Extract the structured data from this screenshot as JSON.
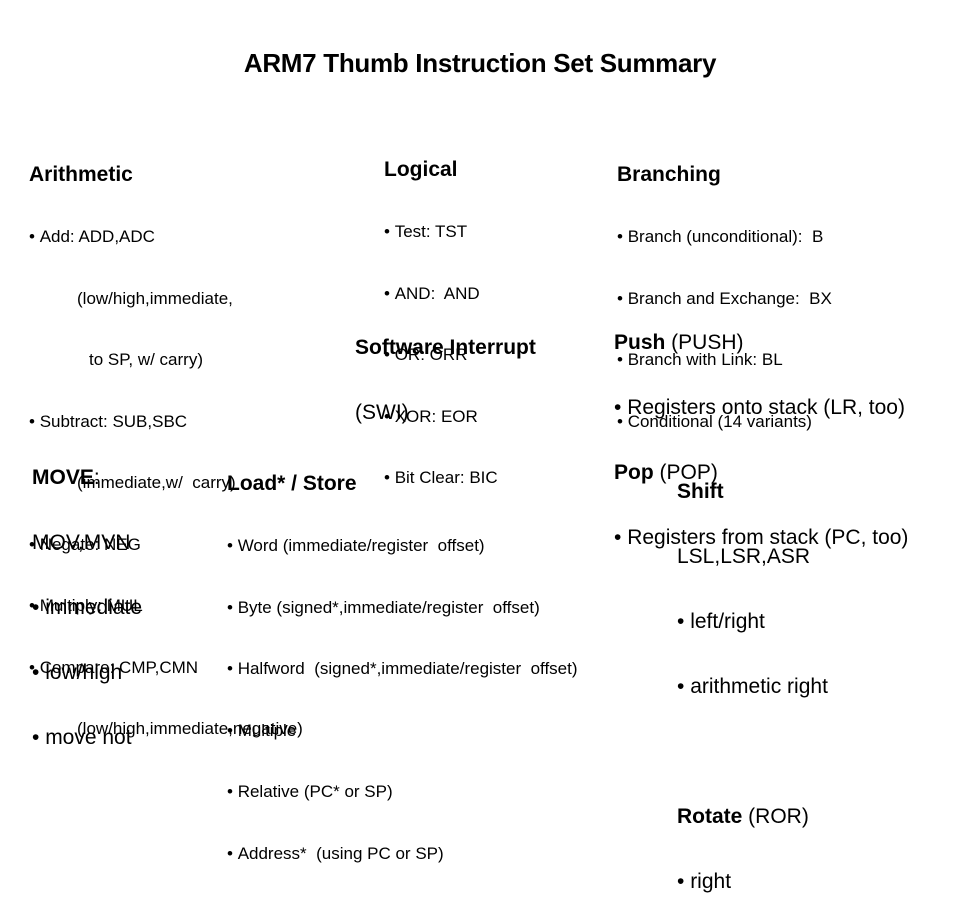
{
  "title": "ARM7 Thumb Instruction Set Summary",
  "arithmetic": {
    "heading": "Arithmetic",
    "lines": [
      {
        "text": "Add: ADD,ADC",
        "bullet": true,
        "indent": 0
      },
      {
        "text": "(low/high,immediate,",
        "bullet": false,
        "indent": 1
      },
      {
        "text": "to SP, w/ carry)",
        "bullet": false,
        "indent": 2
      },
      {
        "text": "Subtract: SUB,SBC",
        "bullet": true,
        "indent": 0
      },
      {
        "text": "(immediate,w/  carry)",
        "bullet": false,
        "indent": 1
      },
      {
        "text": "Negate: NEG",
        "bullet": true,
        "indent": 0
      },
      {
        "text": "Multiply: MUL",
        "bullet": true,
        "indent": 0
      },
      {
        "text": "Compare: CMP,CMN",
        "bullet": true,
        "indent": 0
      },
      {
        "text": "(low/high,immediate,negative)",
        "bullet": false,
        "indent": 1
      }
    ]
  },
  "logical": {
    "heading": "Logical",
    "items": [
      "Test: TST",
      "AND:  AND",
      "OR: ORR",
      "XOR: EOR",
      "Bit Clear: BIC"
    ]
  },
  "branching": {
    "heading": "Branching",
    "items": [
      "Branch (unconditional):  B",
      "Branch and Exchange:  BX",
      "Branch with Link: BL",
      "Conditional (14 variants)"
    ]
  },
  "software_interrupt": {
    "heading": "Software Interrupt",
    "mnemonic": "(SWI)"
  },
  "push": {
    "heading": "Push",
    "mnemonic": " (PUSH)",
    "item": "Registers onto stack (LR, too)"
  },
  "pop": {
    "heading": "Pop",
    "mnemonic": " (POP)",
    "item": "Registers from stack (PC, too)"
  },
  "move": {
    "heading": "MOVE",
    "colon": ":",
    "mnemonics": "MOV,MVN",
    "items": [
      "immediate",
      "low/high",
      "move not"
    ]
  },
  "load_store": {
    "heading": "Load* / Store",
    "items": [
      "Word (immediate/register  offset)",
      "Byte (signed*,immediate/register  offset)",
      "Halfword  (signed*,immediate/register  offset)",
      "Multiple",
      "Relative (PC* or SP)",
      "Address*  (using PC or SP)"
    ]
  },
  "shift": {
    "heading": "Shift",
    "mnemonics": "LSL,LSR,ASR",
    "items": [
      "left/right",
      "arithmetic right"
    ]
  },
  "rotate": {
    "heading": "Rotate",
    "mnemonic": " (ROR)",
    "items": [
      "right"
    ]
  }
}
